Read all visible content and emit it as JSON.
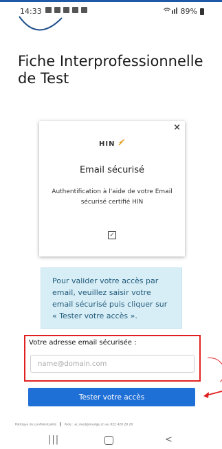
{
  "status_bar": {
    "time": "14:33",
    "battery": "89%"
  },
  "page": {
    "title": "Fiche Interprofessionnelle de Test"
  },
  "auth_card": {
    "close_symbol": "×",
    "logo_text": "HIN",
    "title": "Email sécurisé",
    "description": "Authentification à l'aide de votre Email sécurisé certifié HIN",
    "checkbox_symbol": "✓"
  },
  "info_box": {
    "text": "Pour valider votre accès par email, veuillez saisir votre email sécurisé puis cliquer sur « Tester votre accès »."
  },
  "email_form": {
    "label": "Votre adresse email sécurisée :",
    "value": "",
    "placeholder": "name@domain.com"
  },
  "submit_button": {
    "label": "Tester votre accès"
  },
  "footer": {
    "privacy": "Politique de confidentialité",
    "help": "Aide : ar_med@medge.ch au 022 420 20 20"
  },
  "nav": {
    "recents": "|||",
    "back": "<"
  },
  "colors": {
    "accent": "#1e6fd6",
    "info_bg": "#d8eef6",
    "highlight": "#e02020"
  }
}
